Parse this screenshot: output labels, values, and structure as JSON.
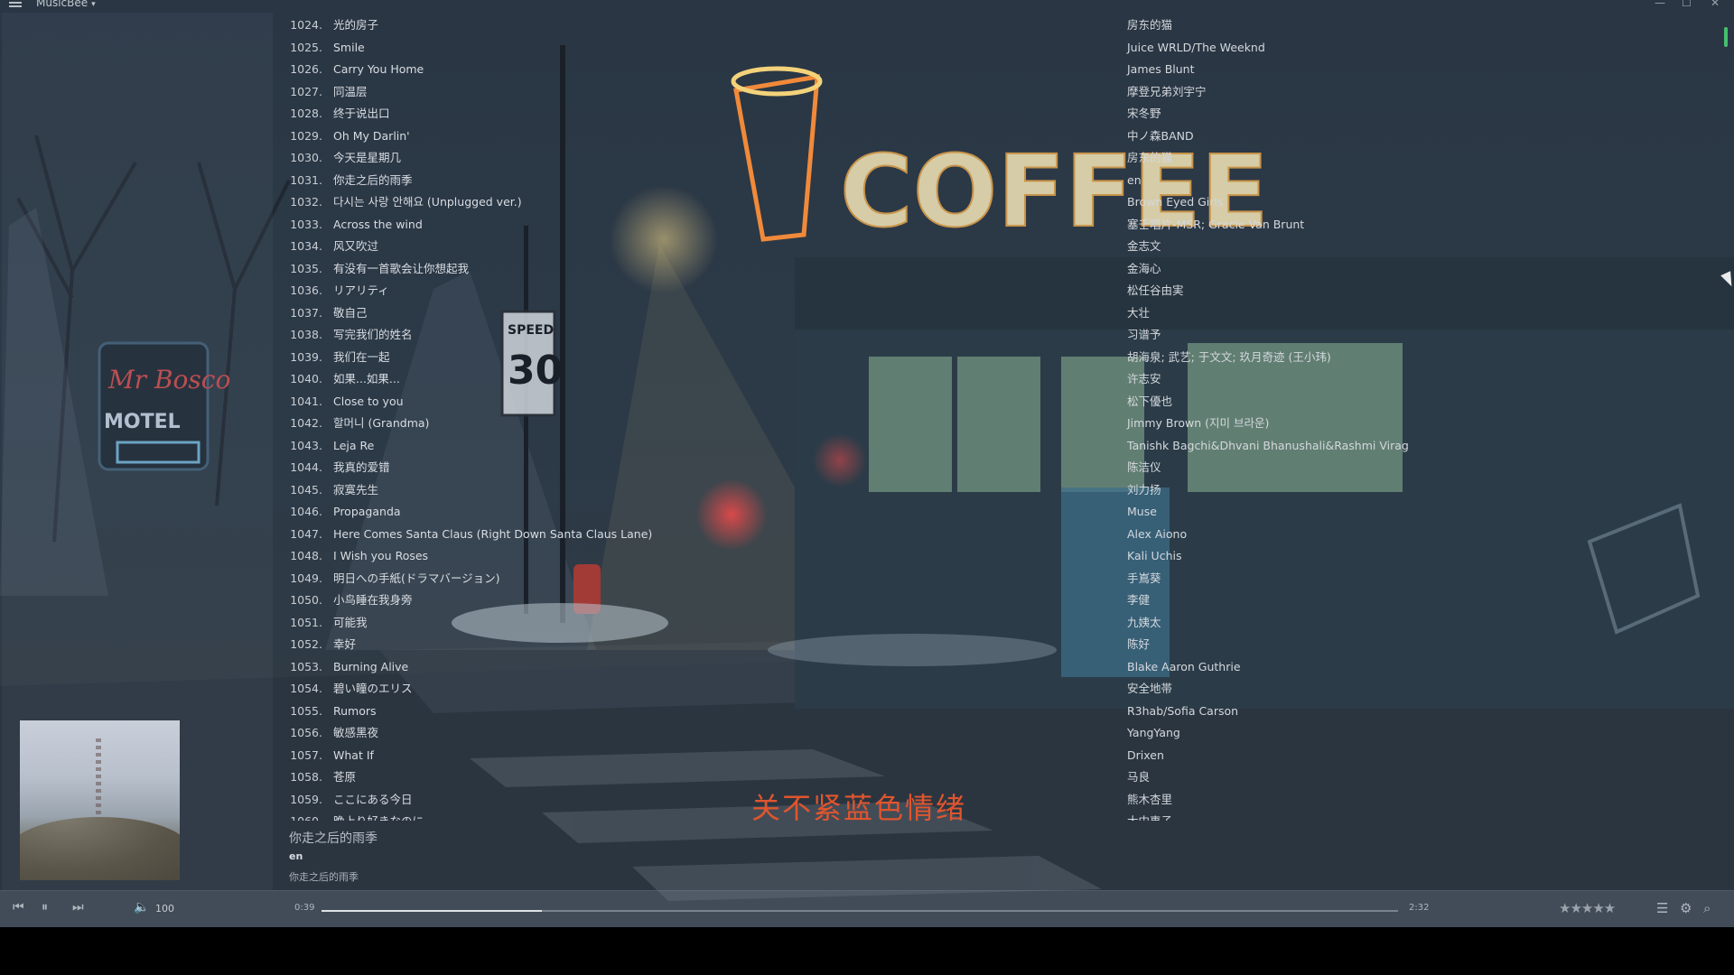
{
  "app": {
    "title": "MusicBee"
  },
  "tracks": [
    {
      "num": "1024.",
      "title": "光的房子",
      "artist": "房东的猫"
    },
    {
      "num": "1025.",
      "title": "Smile",
      "artist": "Juice WRLD/The Weeknd"
    },
    {
      "num": "1026.",
      "title": "Carry You Home",
      "artist": "James Blunt"
    },
    {
      "num": "1027.",
      "title": "同温层",
      "artist": "摩登兄弟刘宇宁"
    },
    {
      "num": "1028.",
      "title": "终于说出口",
      "artist": "宋冬野"
    },
    {
      "num": "1029.",
      "title": "Oh My Darlin'",
      "artist": "中ノ森BAND"
    },
    {
      "num": "1030.",
      "title": "今天是星期几",
      "artist": "房东的猫"
    },
    {
      "num": "1031.",
      "title": "你走之后的雨季",
      "artist": "en",
      "playing": true
    },
    {
      "num": "1032.",
      "title": "다시는 사랑 안해요 (Unplugged ver.)",
      "artist": "Brown Eyed Girls"
    },
    {
      "num": "1033.",
      "title": "Across the wind",
      "artist": "塞壬唱片-MSR; Gracie Van Brunt"
    },
    {
      "num": "1034.",
      "title": "风又吹过",
      "artist": "金志文"
    },
    {
      "num": "1035.",
      "title": "有没有一首歌会让你想起我",
      "artist": "金海心"
    },
    {
      "num": "1036.",
      "title": "リアリティ",
      "artist": "松任谷由実"
    },
    {
      "num": "1037.",
      "title": "敬自己",
      "artist": "大壮"
    },
    {
      "num": "1038.",
      "title": "写完我们的姓名",
      "artist": "习谱予"
    },
    {
      "num": "1039.",
      "title": "我们在一起",
      "artist": "胡海泉; 武艺; 于文文; 玖月奇迹 (王小玮)"
    },
    {
      "num": "1040.",
      "title": "如果...如果...",
      "artist": "许志安"
    },
    {
      "num": "1041.",
      "title": "Close to you",
      "artist": "松下優也"
    },
    {
      "num": "1042.",
      "title": "할머니 (Grandma)",
      "artist": "Jimmy Brown (지미 브라운)"
    },
    {
      "num": "1043.",
      "title": "Leja Re",
      "artist": "Tanishk Bagchi&Dhvani Bhanushali&Rashmi Virag"
    },
    {
      "num": "1044.",
      "title": "我真的爱错",
      "artist": "陈洁仪"
    },
    {
      "num": "1045.",
      "title": "寂寞先生",
      "artist": "刘力扬"
    },
    {
      "num": "1046.",
      "title": "Propaganda",
      "artist": "Muse"
    },
    {
      "num": "1047.",
      "title": "Here Comes Santa Claus (Right Down Santa Claus Lane)",
      "artist": "Alex Aiono"
    },
    {
      "num": "1048.",
      "title": "I Wish you Roses",
      "artist": "Kali Uchis"
    },
    {
      "num": "1049.",
      "title": "明日への手紙(ドラマバージョン)",
      "artist": "手嶌葵"
    },
    {
      "num": "1050.",
      "title": "小鸟睡在我身旁",
      "artist": "李健"
    },
    {
      "num": "1051.",
      "title": "可能我",
      "artist": "九姨太"
    },
    {
      "num": "1052.",
      "title": "幸好",
      "artist": "陈好"
    },
    {
      "num": "1053.",
      "title": "Burning Alive",
      "artist": "Blake Aaron Guthrie"
    },
    {
      "num": "1054.",
      "title": "碧い瞳のエリス",
      "artist": "安全地帯"
    },
    {
      "num": "1055.",
      "title": "Rumors",
      "artist": "R3hab/Sofia Carson"
    },
    {
      "num": "1056.",
      "title": "敏感黑夜",
      "artist": "YangYang"
    },
    {
      "num": "1057.",
      "title": "What If",
      "artist": "Drixen"
    },
    {
      "num": "1058.",
      "title": "苍原",
      "artist": "马良"
    },
    {
      "num": "1059.",
      "title": "ここにある今日",
      "artist": "熊木杏里"
    },
    {
      "num": "1060.",
      "title": "晩上り好きなのに",
      "artist": "大中恵子"
    }
  ],
  "now_playing": {
    "title": "你走之后的雨季",
    "artist": "en",
    "album": "你走之后的雨季",
    "lyric": "关不紧蓝色情绪"
  },
  "player": {
    "volume": "100",
    "elapsed": "0:39",
    "duration": "2:32",
    "progress": 0.205,
    "rating_stars": "★★★★★"
  },
  "icons": [
    "menu-icon",
    "prev-icon",
    "pause-icon",
    "next-icon",
    "volume-icon",
    "queue-icon",
    "settings-icon",
    "search-icon"
  ]
}
